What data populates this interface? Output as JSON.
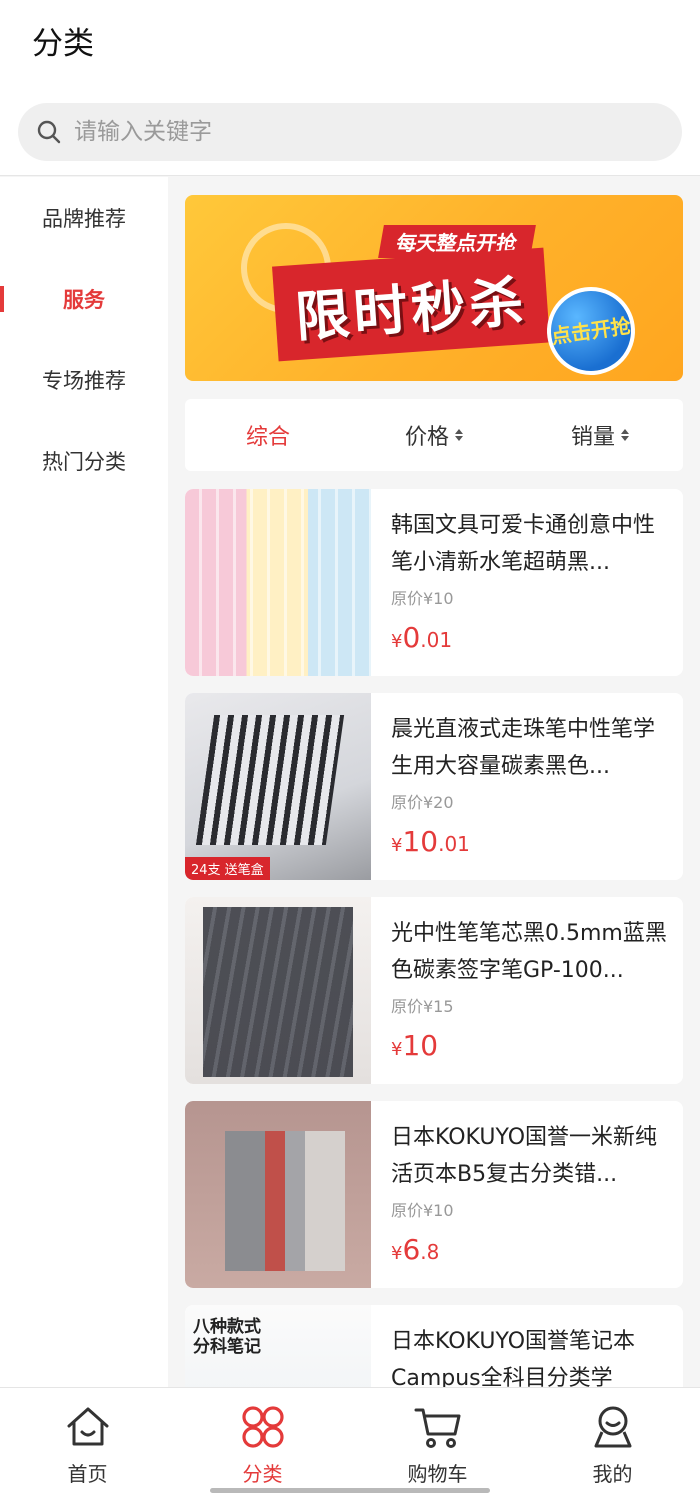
{
  "header": {
    "title": "分类"
  },
  "search": {
    "placeholder": "请输入关键字",
    "icon": "search-icon"
  },
  "sidebar": {
    "items": [
      {
        "label": "品牌推荐",
        "active": false
      },
      {
        "label": "服务",
        "active": true
      },
      {
        "label": "专场推荐",
        "active": false
      },
      {
        "label": "热门分类",
        "active": false
      }
    ]
  },
  "banner": {
    "subtitle": "每天整点开抢",
    "title": "限时秒杀",
    "button": "点击开抢"
  },
  "sort": {
    "items": [
      {
        "label": "综合",
        "active": true
      },
      {
        "label": "价格",
        "active": false
      },
      {
        "label": "销量",
        "active": false
      }
    ]
  },
  "products": [
    {
      "title": "韩国文具可爱卡通创意中性笔小清新水笔超萌黑...",
      "original": "原价¥10",
      "currency": "¥",
      "price_int": "0",
      "price_dec": ".01"
    },
    {
      "title": "晨光直液式走珠笔中性笔学生用大容量碳素黑色...",
      "original": "原价¥20",
      "currency": "¥",
      "price_int": "10",
      "price_dec": ".01",
      "image_tag": "24支 送笔盒"
    },
    {
      "title": "光中性笔笔芯黑0.5mm蓝黑色碳素签字笔GP-100...",
      "original": "原价¥15",
      "currency": "¥",
      "price_int": "10",
      "price_dec": ""
    },
    {
      "title": "日本KOKUYO国誉一米新纯活页本B5复古分类错...",
      "original": "原价¥10",
      "currency": "¥",
      "price_int": "6",
      "price_dec": ".8"
    },
    {
      "title": "日本KOKUYO国誉笔记本Campus全科目分类学",
      "original": "",
      "currency": "",
      "price_int": "",
      "price_dec": "",
      "image_text": "八种款式\n分科笔记"
    }
  ],
  "bottom_nav": {
    "items": [
      {
        "label": "首页",
        "icon": "home-icon",
        "active": false
      },
      {
        "label": "分类",
        "icon": "category-icon",
        "active": true
      },
      {
        "label": "购物车",
        "icon": "cart-icon",
        "active": false
      },
      {
        "label": "我的",
        "icon": "profile-icon",
        "active": false
      }
    ]
  },
  "colors": {
    "accent": "#e43a3a",
    "banner_bg": "#ffb12a",
    "page_bg": "#f5f5f5"
  }
}
